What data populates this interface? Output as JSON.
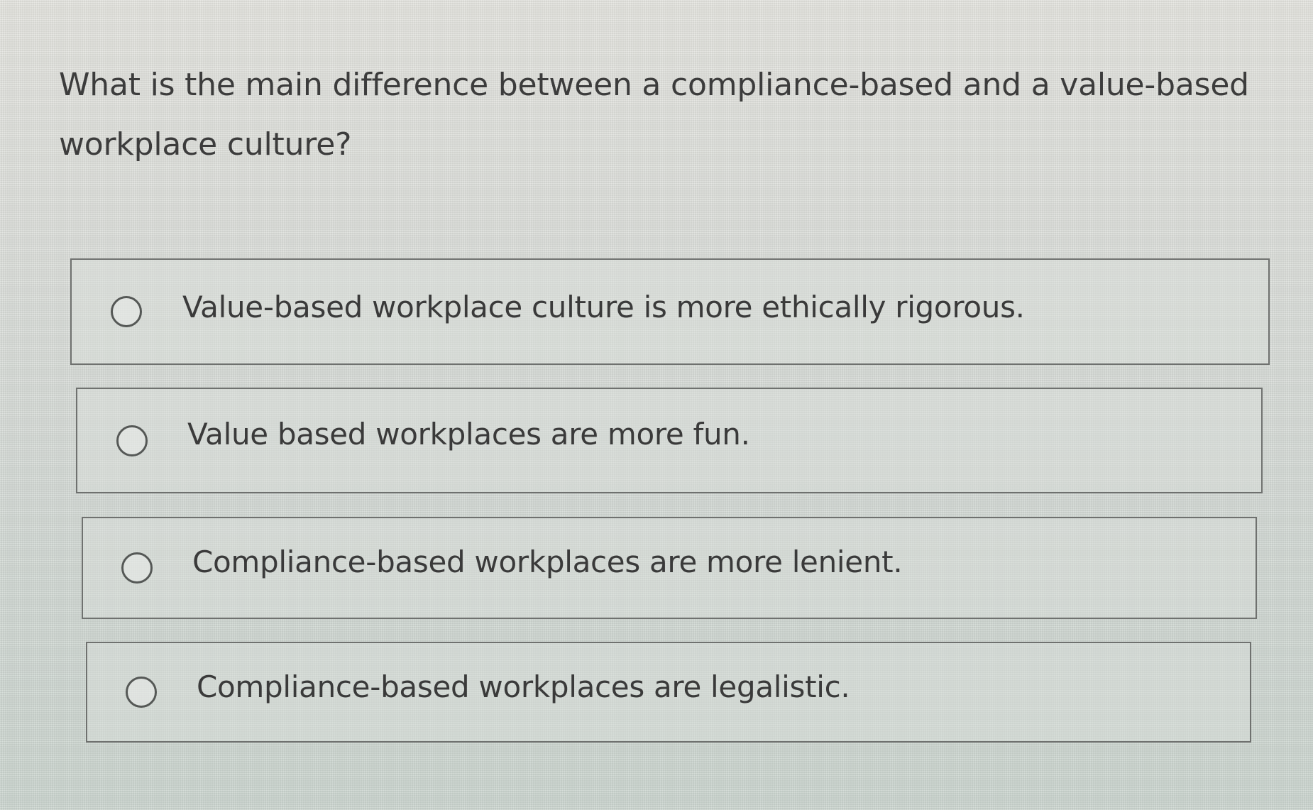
{
  "question": {
    "text": "What is the main difference between a compliance-based and a value-based workplace culture?"
  },
  "options": [
    {
      "label": "Value-based workplace culture is more ethically rigorous.",
      "selected": false
    },
    {
      "label": "Value based workplaces are more fun.",
      "selected": false
    },
    {
      "label": "Compliance-based workplaces are more lenient.",
      "selected": false
    },
    {
      "label": "Compliance-based workplaces are legalistic.",
      "selected": false
    }
  ],
  "colors": {
    "background": "#d8dcd7",
    "text": "#3b3b3b",
    "border": "#6f716f"
  }
}
